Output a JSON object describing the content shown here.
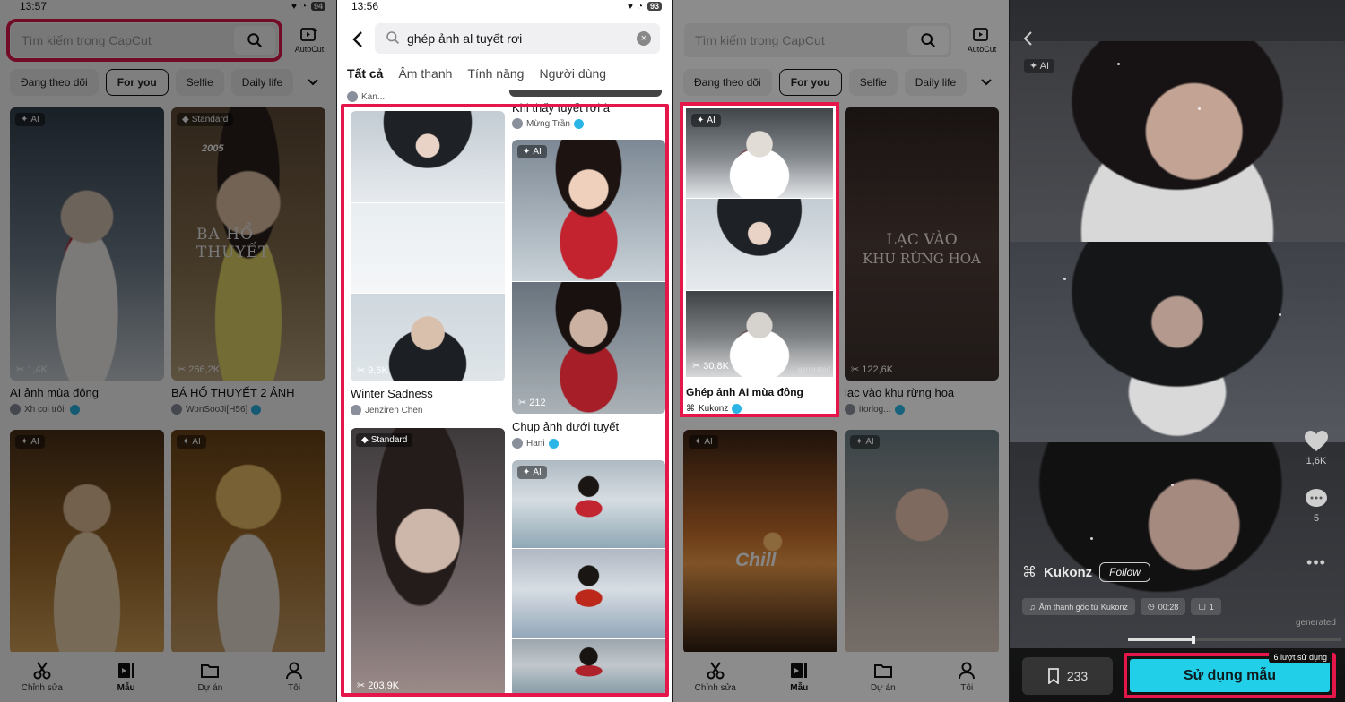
{
  "panel1": {
    "status": {
      "time": "13:57",
      "battery": "94"
    },
    "search": {
      "placeholder": "Tìm kiếm trong CapCut"
    },
    "autocut_label": "AutoCut",
    "chips": [
      "Đang theo dõi",
      "For you",
      "Selfie",
      "Daily life"
    ],
    "cards": [
      {
        "badge": "AI",
        "uses": "1,4K",
        "title": "AI ảnh mùa đông",
        "author": "Xh coi trôii"
      },
      {
        "badge": "Standard",
        "uses": "266,2K",
        "title": "BÁ HỔ THUYẾT 2 ẢNH",
        "author": "WonSooJi[H56]",
        "overlay_text": "BA HỔ THUYẾT",
        "year": "2005"
      },
      {
        "badge": "AI"
      },
      {
        "badge": "AI"
      }
    ],
    "nav": [
      "Chỉnh sửa",
      "Mẫu",
      "Dự án",
      "Tôi"
    ]
  },
  "panel2": {
    "status": {
      "time": "13:56",
      "battery": "93"
    },
    "search": {
      "query": "ghép ảnh al tuyết rơi"
    },
    "tabs": [
      "Tất cả",
      "Âm thanh",
      "Tính năng",
      "Người dùng"
    ],
    "top_author": "Kan...",
    "top_title": "Khi thấy tuyết rơi à",
    "top_title_author": "Mừng Trần",
    "cards": [
      {
        "uses": "9,6K",
        "title": "Winter Sadness",
        "author": "Jenziren Chen"
      },
      {
        "badge": "AI",
        "uses": "212",
        "title": "Chụp ảnh dưới tuyết",
        "author": "Hani"
      },
      {
        "badge": "Standard",
        "uses": "203,9K"
      },
      {
        "badge": "AI"
      }
    ]
  },
  "panel3": {
    "search": {
      "placeholder": "Tìm kiếm trong CapCut"
    },
    "autocut_label": "AutoCut",
    "chips": [
      "Đang theo dõi",
      "For you",
      "Selfie",
      "Daily life"
    ],
    "cards": [
      {
        "badge": "AI",
        "uses": "30,8K",
        "title": "Ghép ảnh AI mùa đông",
        "author": "Kukonz",
        "tag": "generated"
      },
      {
        "uses": "122,6K",
        "title": "lạc vào khu rừng hoa",
        "author": "itorlog...",
        "overlay_line1": "LẠC VÀO",
        "overlay_line2": "KHU RỪNG HOA"
      },
      {
        "badge": "AI",
        "overlay_text": "Chill"
      },
      {
        "badge": "AI"
      }
    ],
    "nav": [
      "Chỉnh sửa",
      "Mẫu",
      "Dự án",
      "Tôi"
    ]
  },
  "panel4": {
    "ai_label": "AI",
    "likes": "1,6K",
    "comments": "5",
    "creator": "Kukonz",
    "follow_label": "Follow",
    "audio": "Âm thanh gốc từ Kukonz",
    "duration": "00:28",
    "clips": "1",
    "generated": "generated",
    "saves": "233",
    "use_label": "Sử dụng mẫu",
    "use_count": "6 lượt sử dụng",
    "progress": 0.3
  }
}
